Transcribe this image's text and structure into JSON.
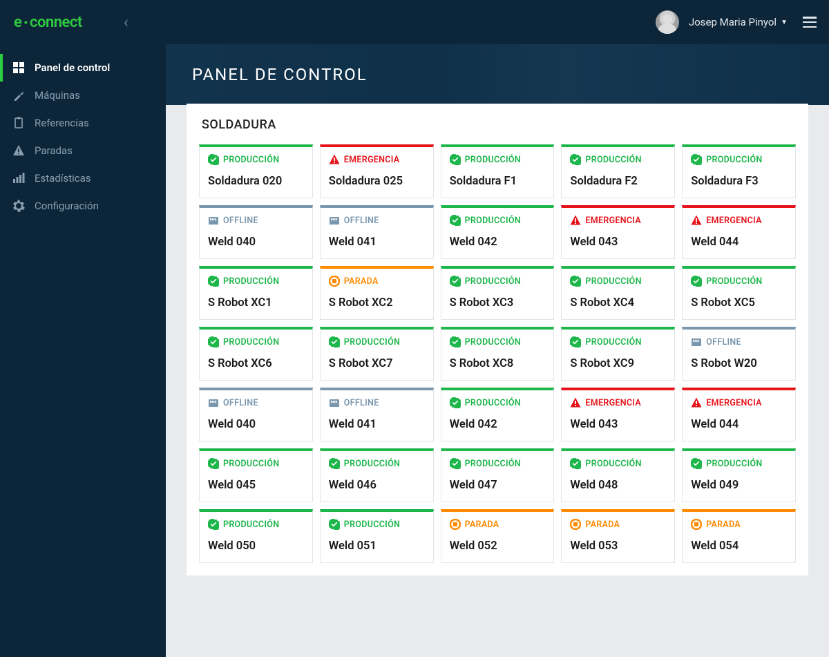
{
  "brand": {
    "e": "e",
    "dot": "·",
    "connect": "connect"
  },
  "user": {
    "first": "Josep Maria",
    "last": "Pinyol"
  },
  "sidebar": {
    "items": [
      {
        "label": "Panel de control",
        "icon": "dashboard",
        "active": true
      },
      {
        "label": "Máquinas",
        "icon": "wrench",
        "active": false
      },
      {
        "label": "Referencias",
        "icon": "clipboard",
        "active": false
      },
      {
        "label": "Paradas",
        "icon": "warning",
        "active": false
      },
      {
        "label": "Estadísticas",
        "icon": "stats",
        "active": false
      },
      {
        "label": "Configuración",
        "icon": "gear",
        "active": false
      }
    ]
  },
  "page_title": "PANEL DE CONTROL",
  "section_title": "SOLDADURA",
  "status_labels": {
    "produccion": "PRODUCCIÓN",
    "emergencia": "EMERGENCIA",
    "offline": "OFFLINE",
    "parada": "PARADA"
  },
  "machines": [
    {
      "name": "Soldadura 020",
      "status": "produccion"
    },
    {
      "name": "Soldadura 025",
      "status": "emergencia"
    },
    {
      "name": "Soldadura F1",
      "status": "produccion"
    },
    {
      "name": "Soldadura F2",
      "status": "produccion"
    },
    {
      "name": "Soldadura F3",
      "status": "produccion"
    },
    {
      "name": "Weld 040",
      "status": "offline"
    },
    {
      "name": "Weld 041",
      "status": "offline"
    },
    {
      "name": "Weld 042",
      "status": "produccion"
    },
    {
      "name": "Weld 043",
      "status": "emergencia"
    },
    {
      "name": "Weld 044",
      "status": "emergencia"
    },
    {
      "name": "S Robot XC1",
      "status": "produccion"
    },
    {
      "name": "S Robot XC2",
      "status": "parada"
    },
    {
      "name": "S Robot XC3",
      "status": "produccion"
    },
    {
      "name": "S Robot XC4",
      "status": "produccion"
    },
    {
      "name": "S Robot XC5",
      "status": "produccion"
    },
    {
      "name": "S Robot XC6",
      "status": "produccion"
    },
    {
      "name": "S Robot XC7",
      "status": "produccion"
    },
    {
      "name": "S Robot XC8",
      "status": "produccion"
    },
    {
      "name": "S Robot XC9",
      "status": "produccion"
    },
    {
      "name": "S Robot W20",
      "status": "offline"
    },
    {
      "name": "Weld 040",
      "status": "offline"
    },
    {
      "name": "Weld 041",
      "status": "offline"
    },
    {
      "name": "Weld 042",
      "status": "produccion"
    },
    {
      "name": "Weld 043",
      "status": "emergencia"
    },
    {
      "name": "Weld 044",
      "status": "emergencia"
    },
    {
      "name": "Weld 045",
      "status": "produccion"
    },
    {
      "name": "Weld 046",
      "status": "produccion"
    },
    {
      "name": "Weld 047",
      "status": "produccion"
    },
    {
      "name": "Weld 048",
      "status": "produccion"
    },
    {
      "name": "Weld 049",
      "status": "produccion"
    },
    {
      "name": "Weld 050",
      "status": "produccion"
    },
    {
      "name": "Weld 051",
      "status": "produccion"
    },
    {
      "name": "Weld 052",
      "status": "parada"
    },
    {
      "name": "Weld 053",
      "status": "parada"
    },
    {
      "name": "Weld 054",
      "status": "parada"
    }
  ]
}
